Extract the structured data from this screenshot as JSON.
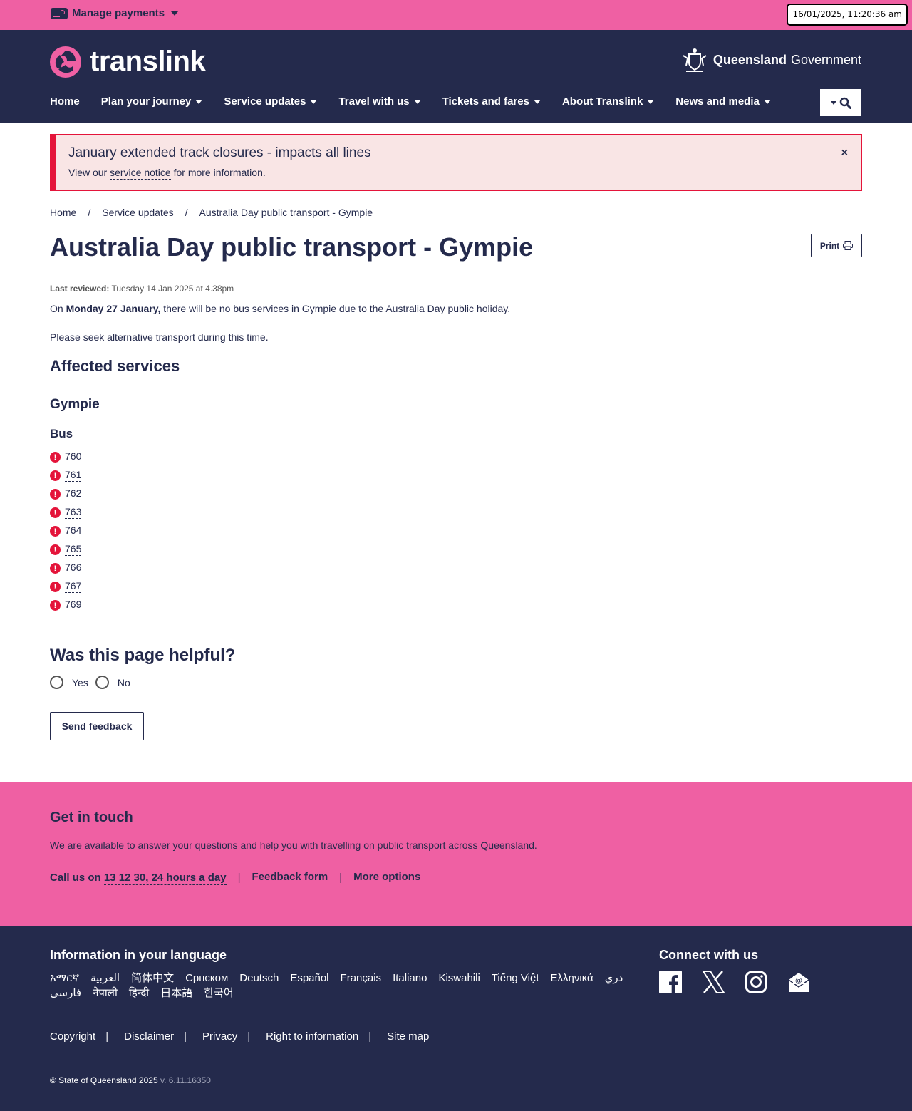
{
  "topbar": {
    "manage_payments": "Manage payments",
    "clock": "16/01/2025, 11:20:36 am"
  },
  "header": {
    "brand": "translink",
    "gov_bold": "Queensland",
    "gov_rest": "Government",
    "nav": [
      "Home",
      "Plan your journey",
      "Service updates",
      "Travel with us",
      "Tickets and fares",
      "About Translink",
      "News and media"
    ]
  },
  "alert": {
    "title": "January extended track closures - impacts all lines",
    "prefix": "View our ",
    "link": "service notice",
    "suffix": " for more information.",
    "close": "×"
  },
  "breadcrumb": {
    "home": "Home",
    "sep": "/",
    "service_updates": "Service updates",
    "current": "Australia Day public transport - Gympie"
  },
  "page": {
    "title": "Australia Day public transport - Gympie",
    "print": "Print",
    "reviewed_label": "Last reviewed:",
    "reviewed_value": "Tuesday 14 Jan 2025 at 4.38pm",
    "p1_pre": "On ",
    "p1_bold": "Monday 27 January,",
    "p1_post": " there will be no bus services in Gympie due to the Australia Day public holiday.",
    "p2": "Please seek alternative transport during this time.",
    "affected": "Affected services",
    "region": "Gympie",
    "mode": "Bus",
    "routes": [
      "760",
      "761",
      "762",
      "763",
      "764",
      "765",
      "766",
      "767",
      "769"
    ]
  },
  "helpful": {
    "title": "Was this page helpful?",
    "yes": "Yes",
    "no": "No",
    "send": "Send feedback"
  },
  "touch": {
    "title": "Get in touch",
    "text": "We are available to answer your questions and help you with travelling on public transport across Queensland.",
    "call_pre": "Call us on ",
    "call_num": "13 12 30",
    "call_post": ", 24 hours a day",
    "feedback": "Feedback form",
    "more": "More options",
    "sep": "|"
  },
  "footer": {
    "lang_title": "Information in your language",
    "languages": [
      "አማርኛ",
      "العربية",
      "简体中文",
      "Српском",
      "Deutsch",
      "Español",
      "Français",
      "Italiano",
      "Kiswahili",
      "Tiếng Việt",
      "Ελληνικά",
      "دري",
      "فارسی",
      "नेपाली",
      "हिन्दी",
      "日本語",
      "한국어"
    ],
    "connect_title": "Connect with us",
    "legal": [
      "Copyright",
      "Disclaimer",
      "Privacy",
      "Right to information",
      "Site map"
    ],
    "copyright": "© State of Queensland 2025",
    "version": "v. 6.11.16350"
  },
  "colors": {
    "pink": "#ef60a3",
    "navy": "#242a4c",
    "alert_red": "#e4143a"
  }
}
